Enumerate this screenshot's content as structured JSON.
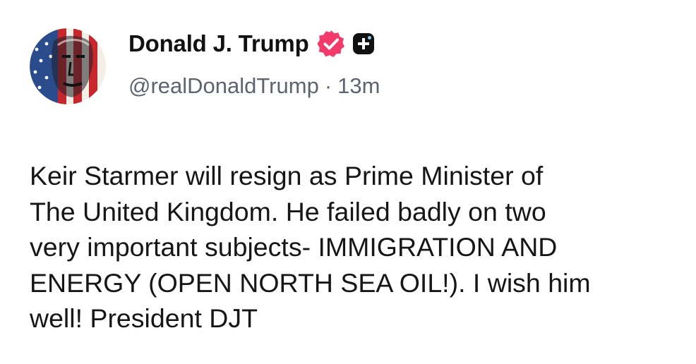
{
  "post": {
    "author": {
      "display_name": "Donald J. Trump",
      "handle": "@realDonaldTrump",
      "avatar_icon": "flag-portrait-avatar",
      "verified_icon": "verified-badge-icon",
      "verified_color": "#f23b6a",
      "badge_icon": "plus-badge-icon"
    },
    "separator": "·",
    "time_ago": "13m",
    "text": "Keir Starmer will resign as Prime Minister of\nThe United Kingdom. He failed badly on two\nvery important subjects- IMMIGRATION AND\nENERGY (OPEN NORTH SEA OIL!). I wish him\nwell! President DJT"
  }
}
